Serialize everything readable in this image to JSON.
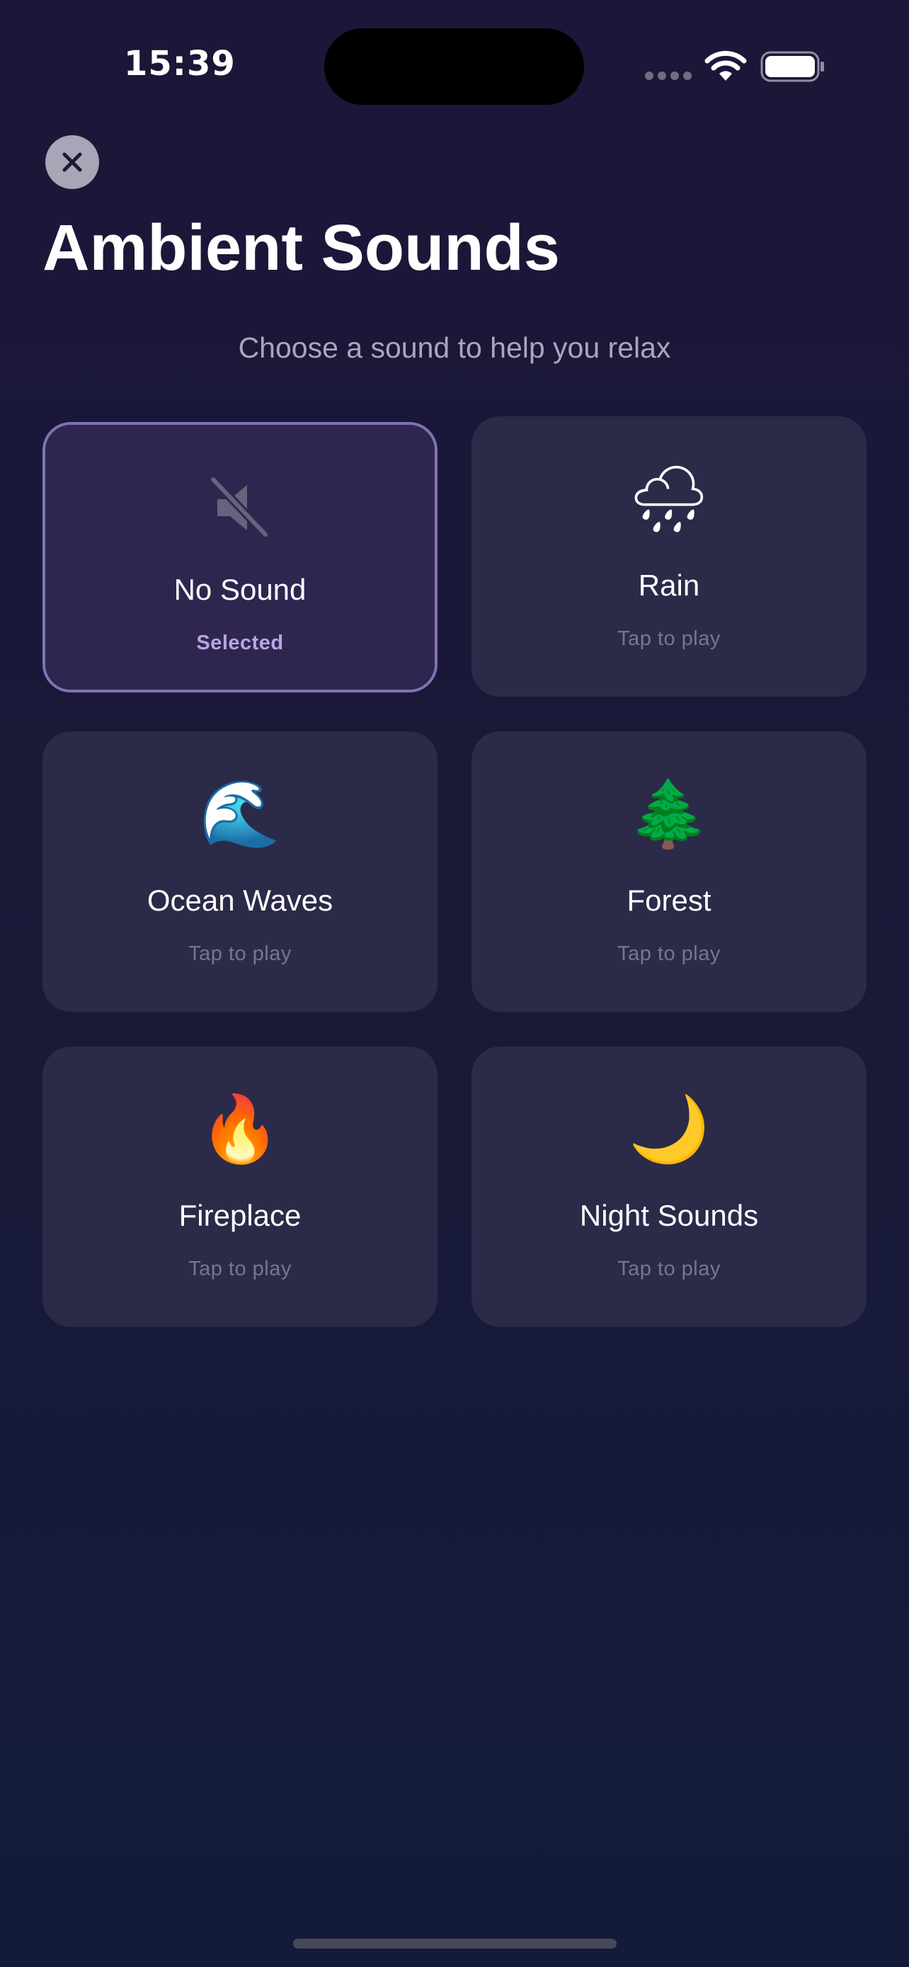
{
  "status_bar": {
    "time": "15:39"
  },
  "header": {
    "title": "Ambient Sounds",
    "subtitle": "Choose a sound to help you relax"
  },
  "sounds": [
    {
      "label": "No Sound",
      "status": "Selected",
      "icon": "speaker-muted-icon"
    },
    {
      "label": "Rain",
      "status": "Tap to play",
      "icon": "rain-cloud-icon",
      "glyph": "🌧"
    },
    {
      "label": "Ocean Waves",
      "status": "Tap to play",
      "icon": "ocean-wave-icon",
      "glyph": "🌊"
    },
    {
      "label": "Forest",
      "status": "Tap to play",
      "icon": "evergreen-tree-icon",
      "glyph": "🌲"
    },
    {
      "label": "Fireplace",
      "status": "Tap to play",
      "icon": "fire-icon",
      "glyph": "🔥"
    },
    {
      "label": "Night Sounds",
      "status": "Tap to play",
      "icon": "crescent-moon-icon",
      "glyph": "🌙"
    }
  ],
  "selected_index": 0,
  "colors": {
    "accent": "#7f73b5",
    "selected_text": "#b6a7e3",
    "card_background": "#2b2a48",
    "selected_card_background": "#2f2650"
  }
}
